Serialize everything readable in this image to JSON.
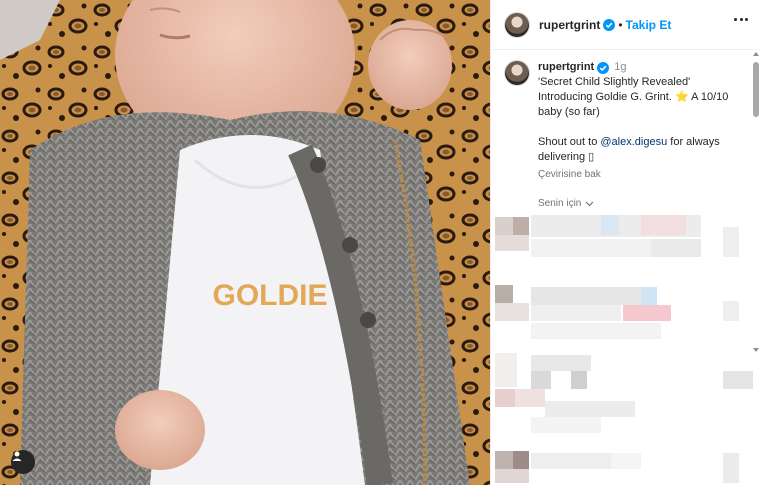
{
  "post": {
    "username": "rupertgrint",
    "follow_label": "Takip Et",
    "separator": "•"
  },
  "caption": {
    "username": "rupertgrint",
    "time": "1g",
    "line_a": "'Secret Child Slightly Revealed'",
    "line_b": "Introducing Goldie G. Grint. ⭐ A 10/10",
    "line_c": "baby (so far)",
    "line_d_prefix": "Shout out to ",
    "mention": "@alex.digesu",
    "line_d_suffix": " for always",
    "line_e": "delivering ▯",
    "see_translation": "Çevirisine bak",
    "for_you": "Senin için"
  },
  "photo": {
    "shirt_text": "GOLDIE"
  },
  "colors": {
    "accent": "#0095f6",
    "verified": "#0095f6",
    "mention": "#00376b"
  },
  "icons": [
    "verified-badge-icon",
    "more-options-icon",
    "tagged-user-icon",
    "chevron-down-icon"
  ]
}
